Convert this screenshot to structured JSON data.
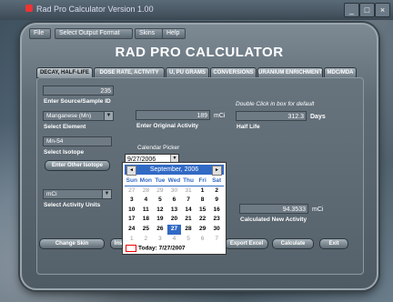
{
  "window": {
    "title": "Rad Pro Calculator Version 1.00"
  },
  "menu": [
    "File",
    "Select Output Format",
    "Skins",
    "Help"
  ],
  "app_title": "RAD PRO CALCULATOR",
  "tabs": [
    "DECAY, HALF-LIFE",
    "DOSE RATE, ACTIVITY",
    "U, PU GRAMS",
    "CONVERSIONS",
    "URANIUM ENRICHMENT",
    "MDC/MDA"
  ],
  "form": {
    "source_id_value": "235",
    "source_id_label": "Enter Source/Sample ID",
    "element_value": "Manganese (Mn)",
    "element_label": "Select Element",
    "original_activity_value": "189",
    "original_activity_unit": "mCi",
    "original_activity_label": "Enter Original Activity",
    "half_life_hint": "Double Click in box for default",
    "half_life_value": "312.3",
    "half_life_unit": "Days",
    "half_life_label": "Half Life",
    "isotope_value": "Mn-54",
    "isotope_label": "Select Isotope",
    "other_isotope_button": "Enter Other Isotope",
    "calendar_picker_label": "Calendar Picker",
    "date_value": "9/27/2006",
    "activity_units_value": "mCi",
    "activity_units_label": "Select Activity Units",
    "new_activity_value": "94.3533",
    "new_activity_unit": "mCi",
    "new_activity_label": "Calculated New Activity"
  },
  "calendar": {
    "month_label": "September, 2006",
    "prev": "◄",
    "next": "►",
    "days_of_week": [
      "Sun",
      "Mon",
      "Tue",
      "Wed",
      "Thu",
      "Fri",
      "Sat"
    ],
    "weeks": [
      [
        "27",
        "28",
        "29",
        "30",
        "31",
        "1",
        "2"
      ],
      [
        "3",
        "4",
        "5",
        "6",
        "7",
        "8",
        "9"
      ],
      [
        "10",
        "11",
        "12",
        "13",
        "14",
        "15",
        "16"
      ],
      [
        "17",
        "18",
        "19",
        "20",
        "21",
        "22",
        "23"
      ],
      [
        "24",
        "25",
        "26",
        "27",
        "28",
        "29",
        "30"
      ],
      [
        "1",
        "2",
        "3",
        "4",
        "5",
        "6",
        "7"
      ]
    ],
    "selected": "27",
    "today_label": "Today: 7/27/2007"
  },
  "buttons": {
    "change_skin": "Change Skin",
    "b2": "Inst",
    "export": "Export Excel",
    "calculate": "Calculate",
    "exit": "Exit"
  }
}
